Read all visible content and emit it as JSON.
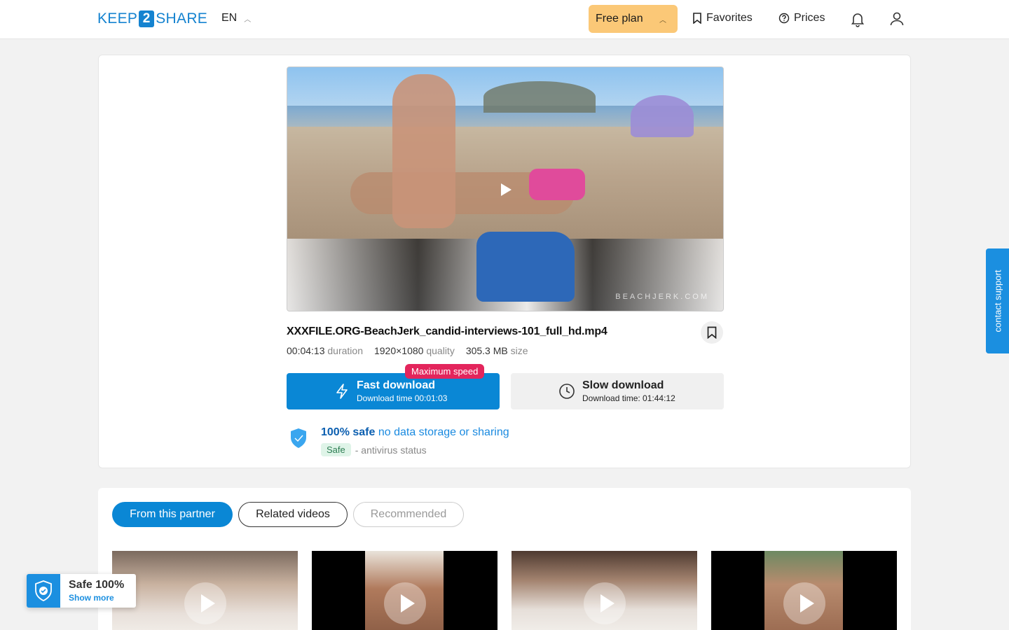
{
  "header": {
    "logo_left": "KEEP",
    "logo_mid": "2",
    "logo_right": "SHARE",
    "language": "EN",
    "plan_label": "Free plan",
    "favorites_label": "Favorites",
    "prices_label": "Prices"
  },
  "file": {
    "name": "XXXFILE.ORG-BeachJerk_candid-interviews-101_full_hd.mp4",
    "duration_value": "00:04:13",
    "duration_label": "duration",
    "quality_value": "1920×1080",
    "quality_label": "quality",
    "size_value": "305.3 MB",
    "size_label": "size",
    "watermark": "BEACHJERK.COM"
  },
  "download": {
    "fast_title": "Fast download",
    "fast_sub": "Download time 00:01:03",
    "badge": "Maximum speed",
    "slow_title": "Slow download",
    "slow_sub": "Download time: 01:44:12"
  },
  "safety": {
    "bold": "100% safe",
    "link": "no data storage or sharing",
    "pill": "Safe",
    "status": "- antivirus status"
  },
  "tabs": [
    "From this partner",
    "Related videos",
    "Recommended"
  ],
  "support_label": "contact support",
  "safe_badge": {
    "title": "Safe 100%",
    "link": "Show more"
  },
  "colors": {
    "accent": "#0a87d5",
    "plan": "#fbc877",
    "badge": "#e3255c"
  }
}
